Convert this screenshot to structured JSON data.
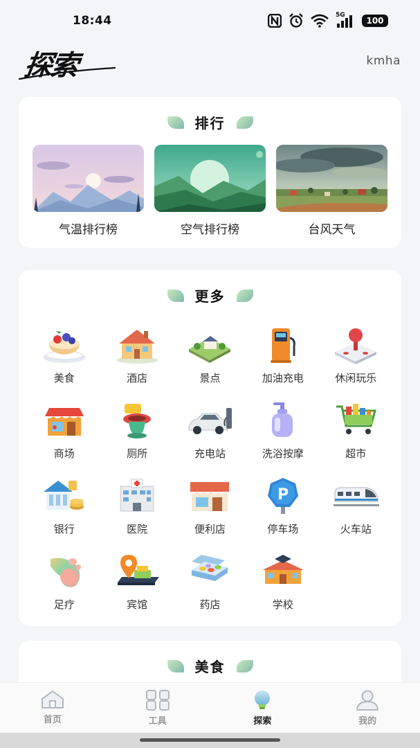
{
  "status_bar": {
    "time": "18:44",
    "icons": [
      "nfc-icon",
      "alarm-icon",
      "wifi-icon",
      "signal-5g-icon"
    ],
    "network": "5G",
    "battery": "100"
  },
  "header": {
    "brand": "探索",
    "username": "kmha"
  },
  "ranking": {
    "title": "排行",
    "items": [
      {
        "label": "气温排行榜",
        "icon": "temperature-landscape-image"
      },
      {
        "label": "空气排行榜",
        "icon": "air-landscape-image"
      },
      {
        "label": "台风天气",
        "icon": "typhoon-landscape-image"
      }
    ]
  },
  "more": {
    "title": "更多",
    "items": [
      {
        "label": "美食",
        "icon": "cake-icon"
      },
      {
        "label": "酒店",
        "icon": "hotel-icon"
      },
      {
        "label": "景点",
        "icon": "scenic-spot-icon"
      },
      {
        "label": "加油充电",
        "icon": "fuel-pump-icon"
      },
      {
        "label": "休闲玩乐",
        "icon": "joystick-icon"
      },
      {
        "label": "商场",
        "icon": "mall-icon"
      },
      {
        "label": "厕所",
        "icon": "toilet-icon"
      },
      {
        "label": "充电站",
        "icon": "ev-charging-icon"
      },
      {
        "label": "洗浴按摩",
        "icon": "soap-bottle-icon"
      },
      {
        "label": "超市",
        "icon": "shopping-cart-icon"
      },
      {
        "label": "银行",
        "icon": "bank-icon"
      },
      {
        "label": "医院",
        "icon": "hospital-icon"
      },
      {
        "label": "便利店",
        "icon": "convenience-store-icon"
      },
      {
        "label": "停车场",
        "icon": "parking-icon"
      },
      {
        "label": "火车站",
        "icon": "train-icon"
      },
      {
        "label": "足疗",
        "icon": "foot-icon"
      },
      {
        "label": "宾馆",
        "icon": "guesthouse-pin-icon"
      },
      {
        "label": "药店",
        "icon": "pill-box-icon"
      },
      {
        "label": "学校",
        "icon": "school-icon"
      }
    ]
  },
  "food": {
    "title": "美食"
  },
  "tab_bar": {
    "tabs": [
      {
        "label": "首页",
        "icon": "home-icon",
        "active": false
      },
      {
        "label": "工具",
        "icon": "grid-icon",
        "active": false
      },
      {
        "label": "探索",
        "icon": "bulb-icon",
        "active": true
      },
      {
        "label": "我的",
        "icon": "user-icon",
        "active": false
      }
    ]
  },
  "colors": {
    "background": "#f4f5f7",
    "card": "#ffffff",
    "leaf_accent": "#7fb9a8",
    "active_icon": "#6fb2d6"
  }
}
